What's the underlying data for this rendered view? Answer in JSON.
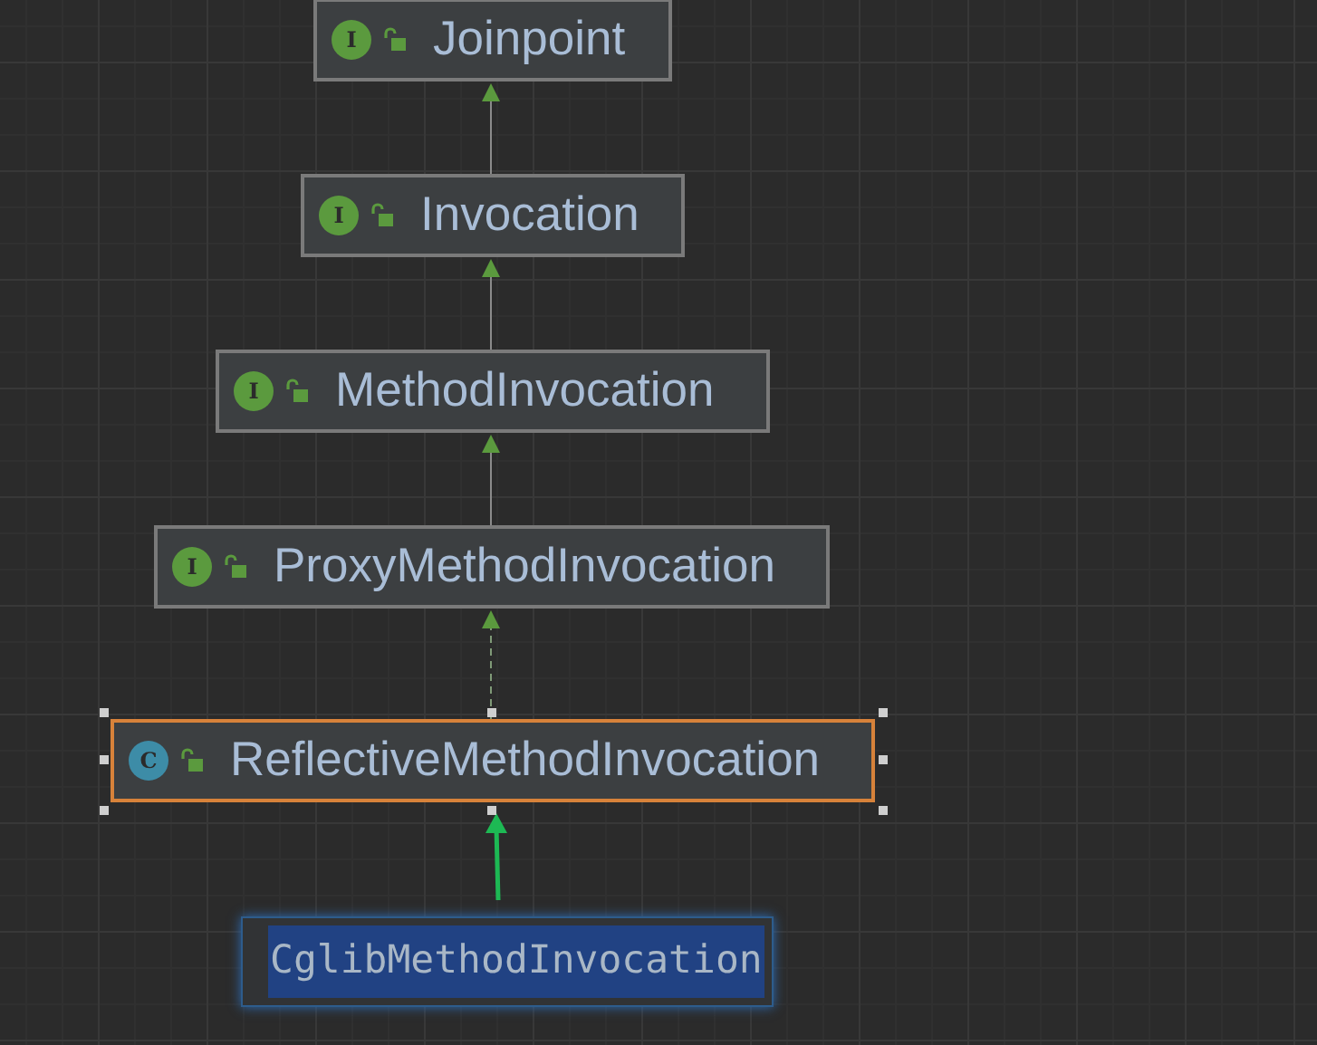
{
  "diagram": {
    "nodes": [
      {
        "kind": "interface",
        "badge": "I",
        "name": "Joinpoint",
        "selected": false
      },
      {
        "kind": "interface",
        "badge": "I",
        "name": "Invocation",
        "selected": false
      },
      {
        "kind": "interface",
        "badge": "I",
        "name": "MethodInvocation",
        "selected": false
      },
      {
        "kind": "interface",
        "badge": "I",
        "name": "ProxyMethodInvocation",
        "selected": false
      },
      {
        "kind": "class",
        "badge": "C",
        "name": "ReflectiveMethodInvocation",
        "selected": true
      }
    ],
    "edges": [
      {
        "kind": "extends"
      },
      {
        "kind": "extends"
      },
      {
        "kind": "extends"
      },
      {
        "kind": "implements"
      }
    ]
  },
  "editor": {
    "value": "CglibMethodInvocation",
    "text_selected": true
  }
}
